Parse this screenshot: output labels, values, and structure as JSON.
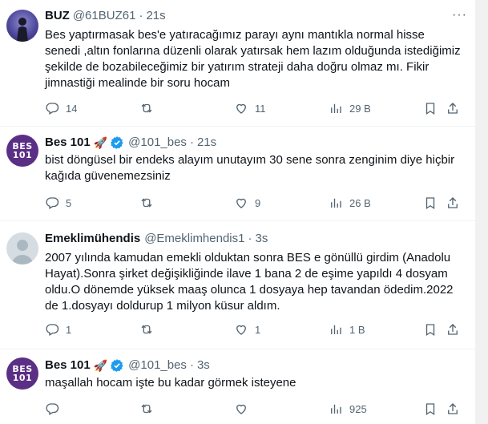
{
  "tweets": [
    {
      "name": "BUZ",
      "handle": "@61BUZ61",
      "dot": "·",
      "time": "21s",
      "body": "Bes yaptırmasak bes'e yatıracağımız parayı aynı mantıkla normal hisse senedi ,altın fonlarına düzenli olarak yatırsak hem lazım olduğunda istediğimiz  şekilde de bozabileceğimiz bir yatırım strateji daha doğru olmaz mı. Fikir jimnastiği mealinde bir soru hocam",
      "replies": "14",
      "retweets": "",
      "likes": "11",
      "views": "29 B"
    },
    {
      "name": "Bes 101",
      "emoji": "🚀",
      "handle": "@101_bes",
      "dot": "·",
      "time": "21s",
      "avatar_text": "BES\n101",
      "body": "bist döngüsel bir endeks alayım unutayım 30 sene sonra zenginim diye hiçbir kağıda güvenemezsiniz",
      "replies": "5",
      "retweets": "",
      "likes": "9",
      "views": "26 B"
    },
    {
      "name": "Emeklimühendis",
      "handle": "@Emeklimhendis1",
      "dot": "·",
      "time": "3s",
      "body": "2007 yılında kamudan emekli olduktan sonra BES e gönüllü girdim (Anadolu Hayat).Sonra şirket değişikliğinde ilave 1 bana 2 de eşime yapıldı 4 dosyam oldu.O dönemde yüksek maaş olunca 1 dosyaya hep tavandan ödedim.2022 de 1.dosyayı doldurup 1 milyon küsur aldım.",
      "replies": "1",
      "retweets": "",
      "likes": "1",
      "views": "1 B"
    },
    {
      "name": "Bes 101",
      "emoji": "🚀",
      "handle": "@101_bes",
      "dot": "·",
      "time": "3s",
      "avatar_text": "BES\n101",
      "body": "maşallah hocam işte bu kadar görmek isteyene",
      "replies": "",
      "retweets": "",
      "likes": "",
      "views": "925"
    }
  ],
  "more_label": "···",
  "colors": {
    "text": "#0f1419",
    "secondary": "#536471",
    "verified": "#1d9bf0",
    "border": "#eff3f4"
  }
}
